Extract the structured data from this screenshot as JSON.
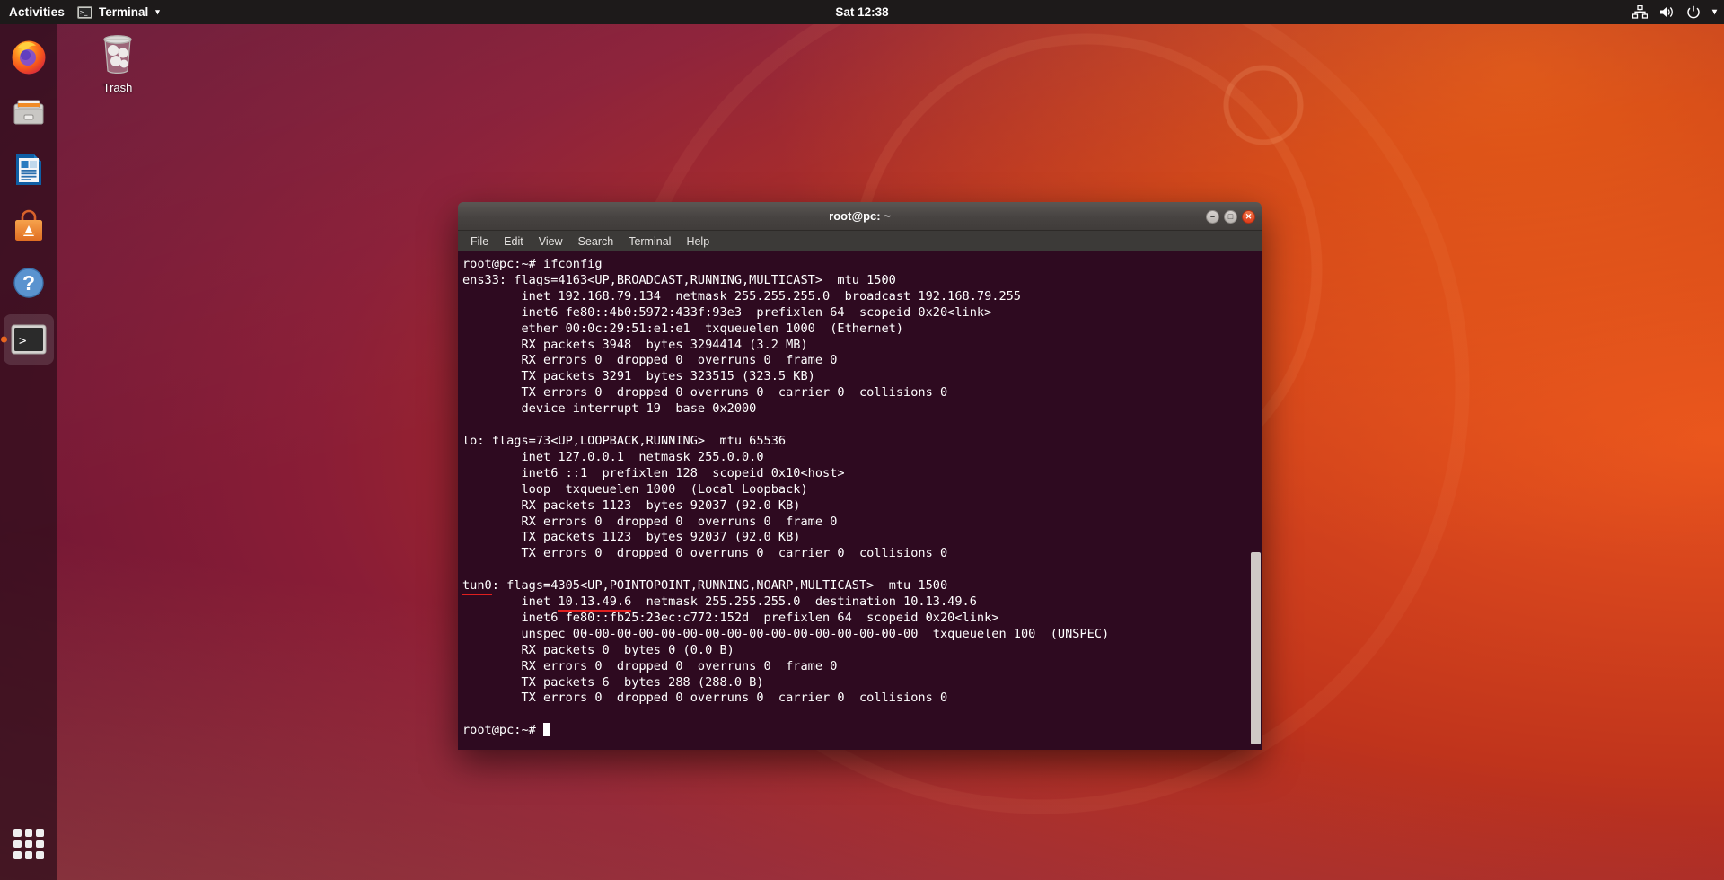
{
  "topbar": {
    "activities": "Activities",
    "app_name": "Terminal",
    "app_icon_glyph": ">_",
    "caret_glyph": "▾",
    "clock": "Sat 12:38",
    "tray": [
      {
        "name": "network-icon",
        "glyph": "network"
      },
      {
        "name": "volume-icon",
        "glyph": "volume"
      },
      {
        "name": "power-icon",
        "glyph": "power"
      },
      {
        "name": "system-menu-caret-icon",
        "glyph": "▾"
      }
    ]
  },
  "dock": {
    "items": [
      {
        "name": "firefox",
        "label": "Firefox",
        "active": false
      },
      {
        "name": "files",
        "label": "Files",
        "active": false
      },
      {
        "name": "libreoffice-writer",
        "label": "LibreOffice Writer",
        "active": false
      },
      {
        "name": "ubuntu-software",
        "label": "Ubuntu Software",
        "active": false
      },
      {
        "name": "help",
        "label": "Help",
        "active": false
      },
      {
        "name": "terminal",
        "label": "Terminal",
        "active": true
      }
    ],
    "show_apps_label": "Show Applications"
  },
  "desktop": {
    "icons": [
      {
        "name": "trash",
        "label": "Trash"
      }
    ]
  },
  "window": {
    "title": "root@pc: ~",
    "controls": {
      "minimize": "–",
      "maximize": "□",
      "close": "✕"
    },
    "menus": [
      "File",
      "Edit",
      "View",
      "Search",
      "Terminal",
      "Help"
    ]
  },
  "terminal": {
    "prompt": "root@pc:~#",
    "command": "ifconfig",
    "lines": [
      "root@pc:~# ifconfig",
      "ens33: flags=4163<UP,BROADCAST,RUNNING,MULTICAST>  mtu 1500",
      "        inet 192.168.79.134  netmask 255.255.255.0  broadcast 192.168.79.255",
      "        inet6 fe80::4b0:5972:433f:93e3  prefixlen 64  scopeid 0x20<link>",
      "        ether 00:0c:29:51:e1:e1  txqueuelen 1000  (Ethernet)",
      "        RX packets 3948  bytes 3294414 (3.2 MB)",
      "        RX errors 0  dropped 0  overruns 0  frame 0",
      "        TX packets 3291  bytes 323515 (323.5 KB)",
      "        TX errors 0  dropped 0 overruns 0  carrier 0  collisions 0",
      "        device interrupt 19  base 0x2000",
      "",
      "lo: flags=73<UP,LOOPBACK,RUNNING>  mtu 65536",
      "        inet 127.0.0.1  netmask 255.0.0.0",
      "        inet6 ::1  prefixlen 128  scopeid 0x10<host>",
      "        loop  txqueuelen 1000  (Local Loopback)",
      "        RX packets 1123  bytes 92037 (92.0 KB)",
      "        RX errors 0  dropped 0  overruns 0  frame 0",
      "        TX packets 1123  bytes 92037 (92.0 KB)",
      "        TX errors 0  dropped 0 overruns 0  carrier 0  collisions 0",
      ""
    ],
    "tun0": {
      "iface": "tun0",
      "header_rest": ": flags=4305<UP,POINTOPOINT,RUNNING,NOARP,MULTICAST>  mtu 1500",
      "inet_prefix": "        inet ",
      "inet_addr": "10.13.49.6",
      "inet_rest": "  netmask 255.255.255.0  destination 10.13.49.6",
      "rest_lines": [
        "        inet6 fe80::fb25:23ec:c772:152d  prefixlen 64  scopeid 0x20<link>",
        "        unspec 00-00-00-00-00-00-00-00-00-00-00-00-00-00-00-00  txqueuelen 100  (UNSPEC)",
        "        RX packets 0  bytes 0 (0.0 B)",
        "        RX errors 0  dropped 0  overruns 0  frame 0",
        "        TX packets 6  bytes 288 (288.0 B)",
        "        TX errors 0  dropped 0 overruns 0  carrier 0  collisions 0",
        ""
      ]
    },
    "final_prompt": "root@pc:~# "
  },
  "colors": {
    "terminal_bg": "#2e0a20",
    "terminal_fg": "#ffffff",
    "titlebar_bg": "#474341",
    "menubar_bg": "#3c3a38",
    "topbar_bg": "#1d1a1a",
    "accent_orange": "#e8651f",
    "highlight_red": "#e01f1f"
  }
}
